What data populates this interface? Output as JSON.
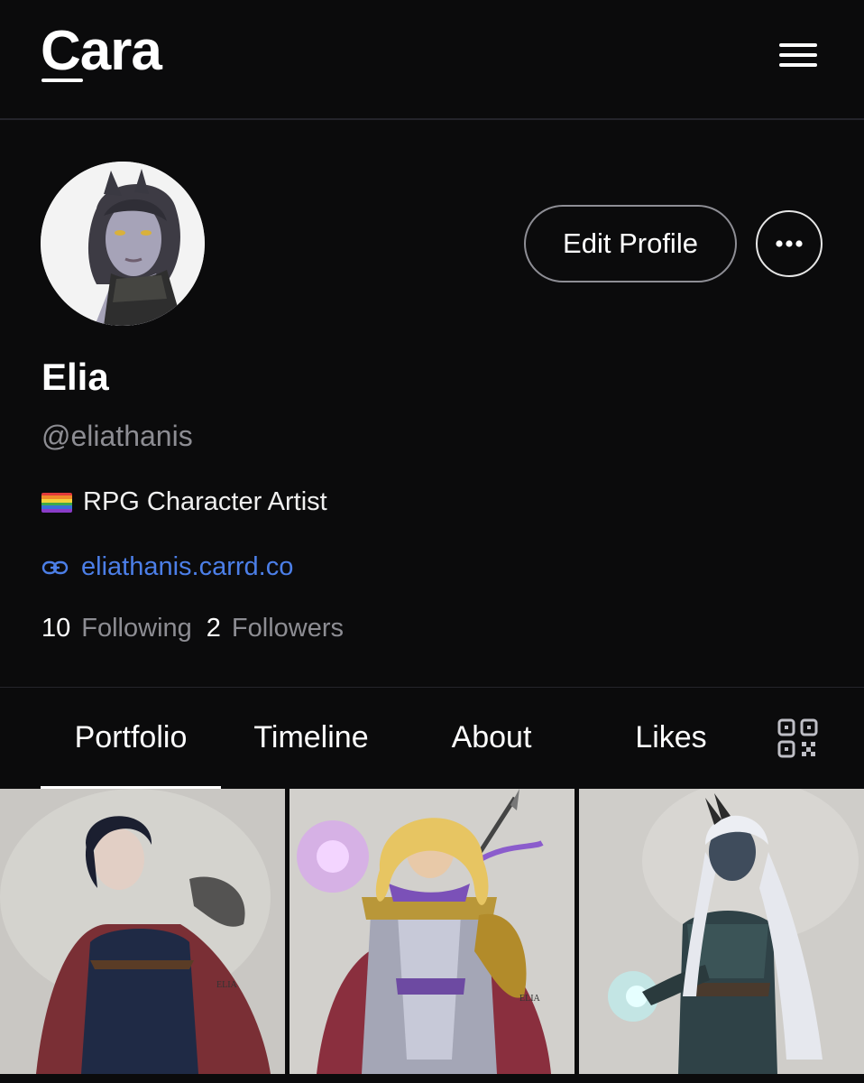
{
  "header": {
    "logo_text": "Cara",
    "menu_icon": "hamburger-menu-icon"
  },
  "profile": {
    "avatar_icon": "profile-avatar",
    "edit_button_label": "Edit Profile",
    "more_icon": "ellipsis-icon",
    "name": "Elia",
    "handle": "@eliathanis",
    "bio": "RPG Character Artist",
    "bio_emoji": "rainbow-flag-icon",
    "link_icon": "link-icon",
    "link": "eliathanis.carrd.co",
    "following_count": "10",
    "following_label": "Following",
    "followers_count": "2",
    "followers_label": "Followers"
  },
  "tabs": [
    {
      "label": "Portfolio",
      "active": true
    },
    {
      "label": "Timeline",
      "active": false
    },
    {
      "label": "About",
      "active": false
    },
    {
      "label": "Likes",
      "active": false
    }
  ],
  "qr_icon": "qr-code-icon",
  "colors": {
    "background": "#0b0b0c",
    "link": "#4c7fe8",
    "muted_text": "#8d8d93"
  },
  "portfolio": [
    {
      "signature": "ELIA"
    },
    {
      "signature": "ELIA"
    },
    {
      "signature": ""
    }
  ]
}
